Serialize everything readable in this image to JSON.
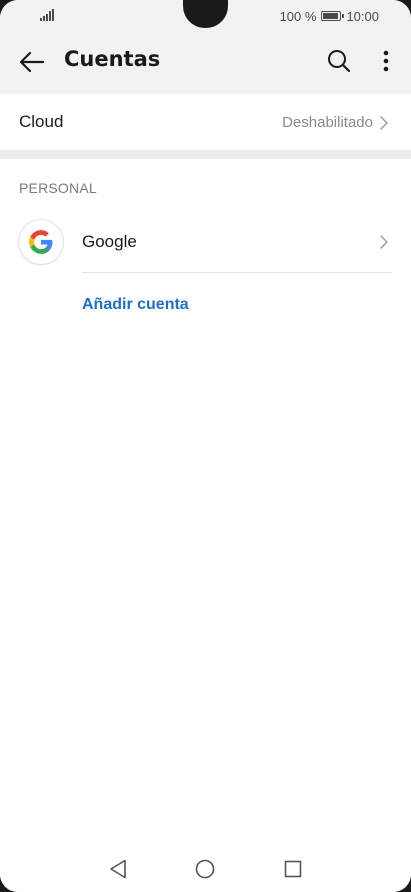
{
  "status_bar": {
    "battery_percent": "100 %",
    "battery_level": 1.0,
    "time": "10:00",
    "icons": [
      "signal-icon",
      "battery-icon"
    ]
  },
  "app_bar": {
    "title": "Cuentas",
    "icons": [
      "back-arrow-icon",
      "search-icon",
      "more-vert-icon"
    ]
  },
  "cloud": {
    "label": "Cloud",
    "status": "Deshabilitado",
    "icon": "chevron-right-icon"
  },
  "personal": {
    "header": "PERSONAL",
    "accounts": [
      {
        "label": "Google",
        "icon": "google-logo-icon"
      }
    ],
    "add_account": "Añadir cuenta"
  },
  "nav_bar": {
    "icons": [
      "back-triangle-icon",
      "home-circle-icon",
      "recents-square-icon"
    ]
  },
  "colors": {
    "app_bar_bg": "#f2f2f2",
    "accent": "#1e6fc6",
    "divider": "#ececec"
  }
}
